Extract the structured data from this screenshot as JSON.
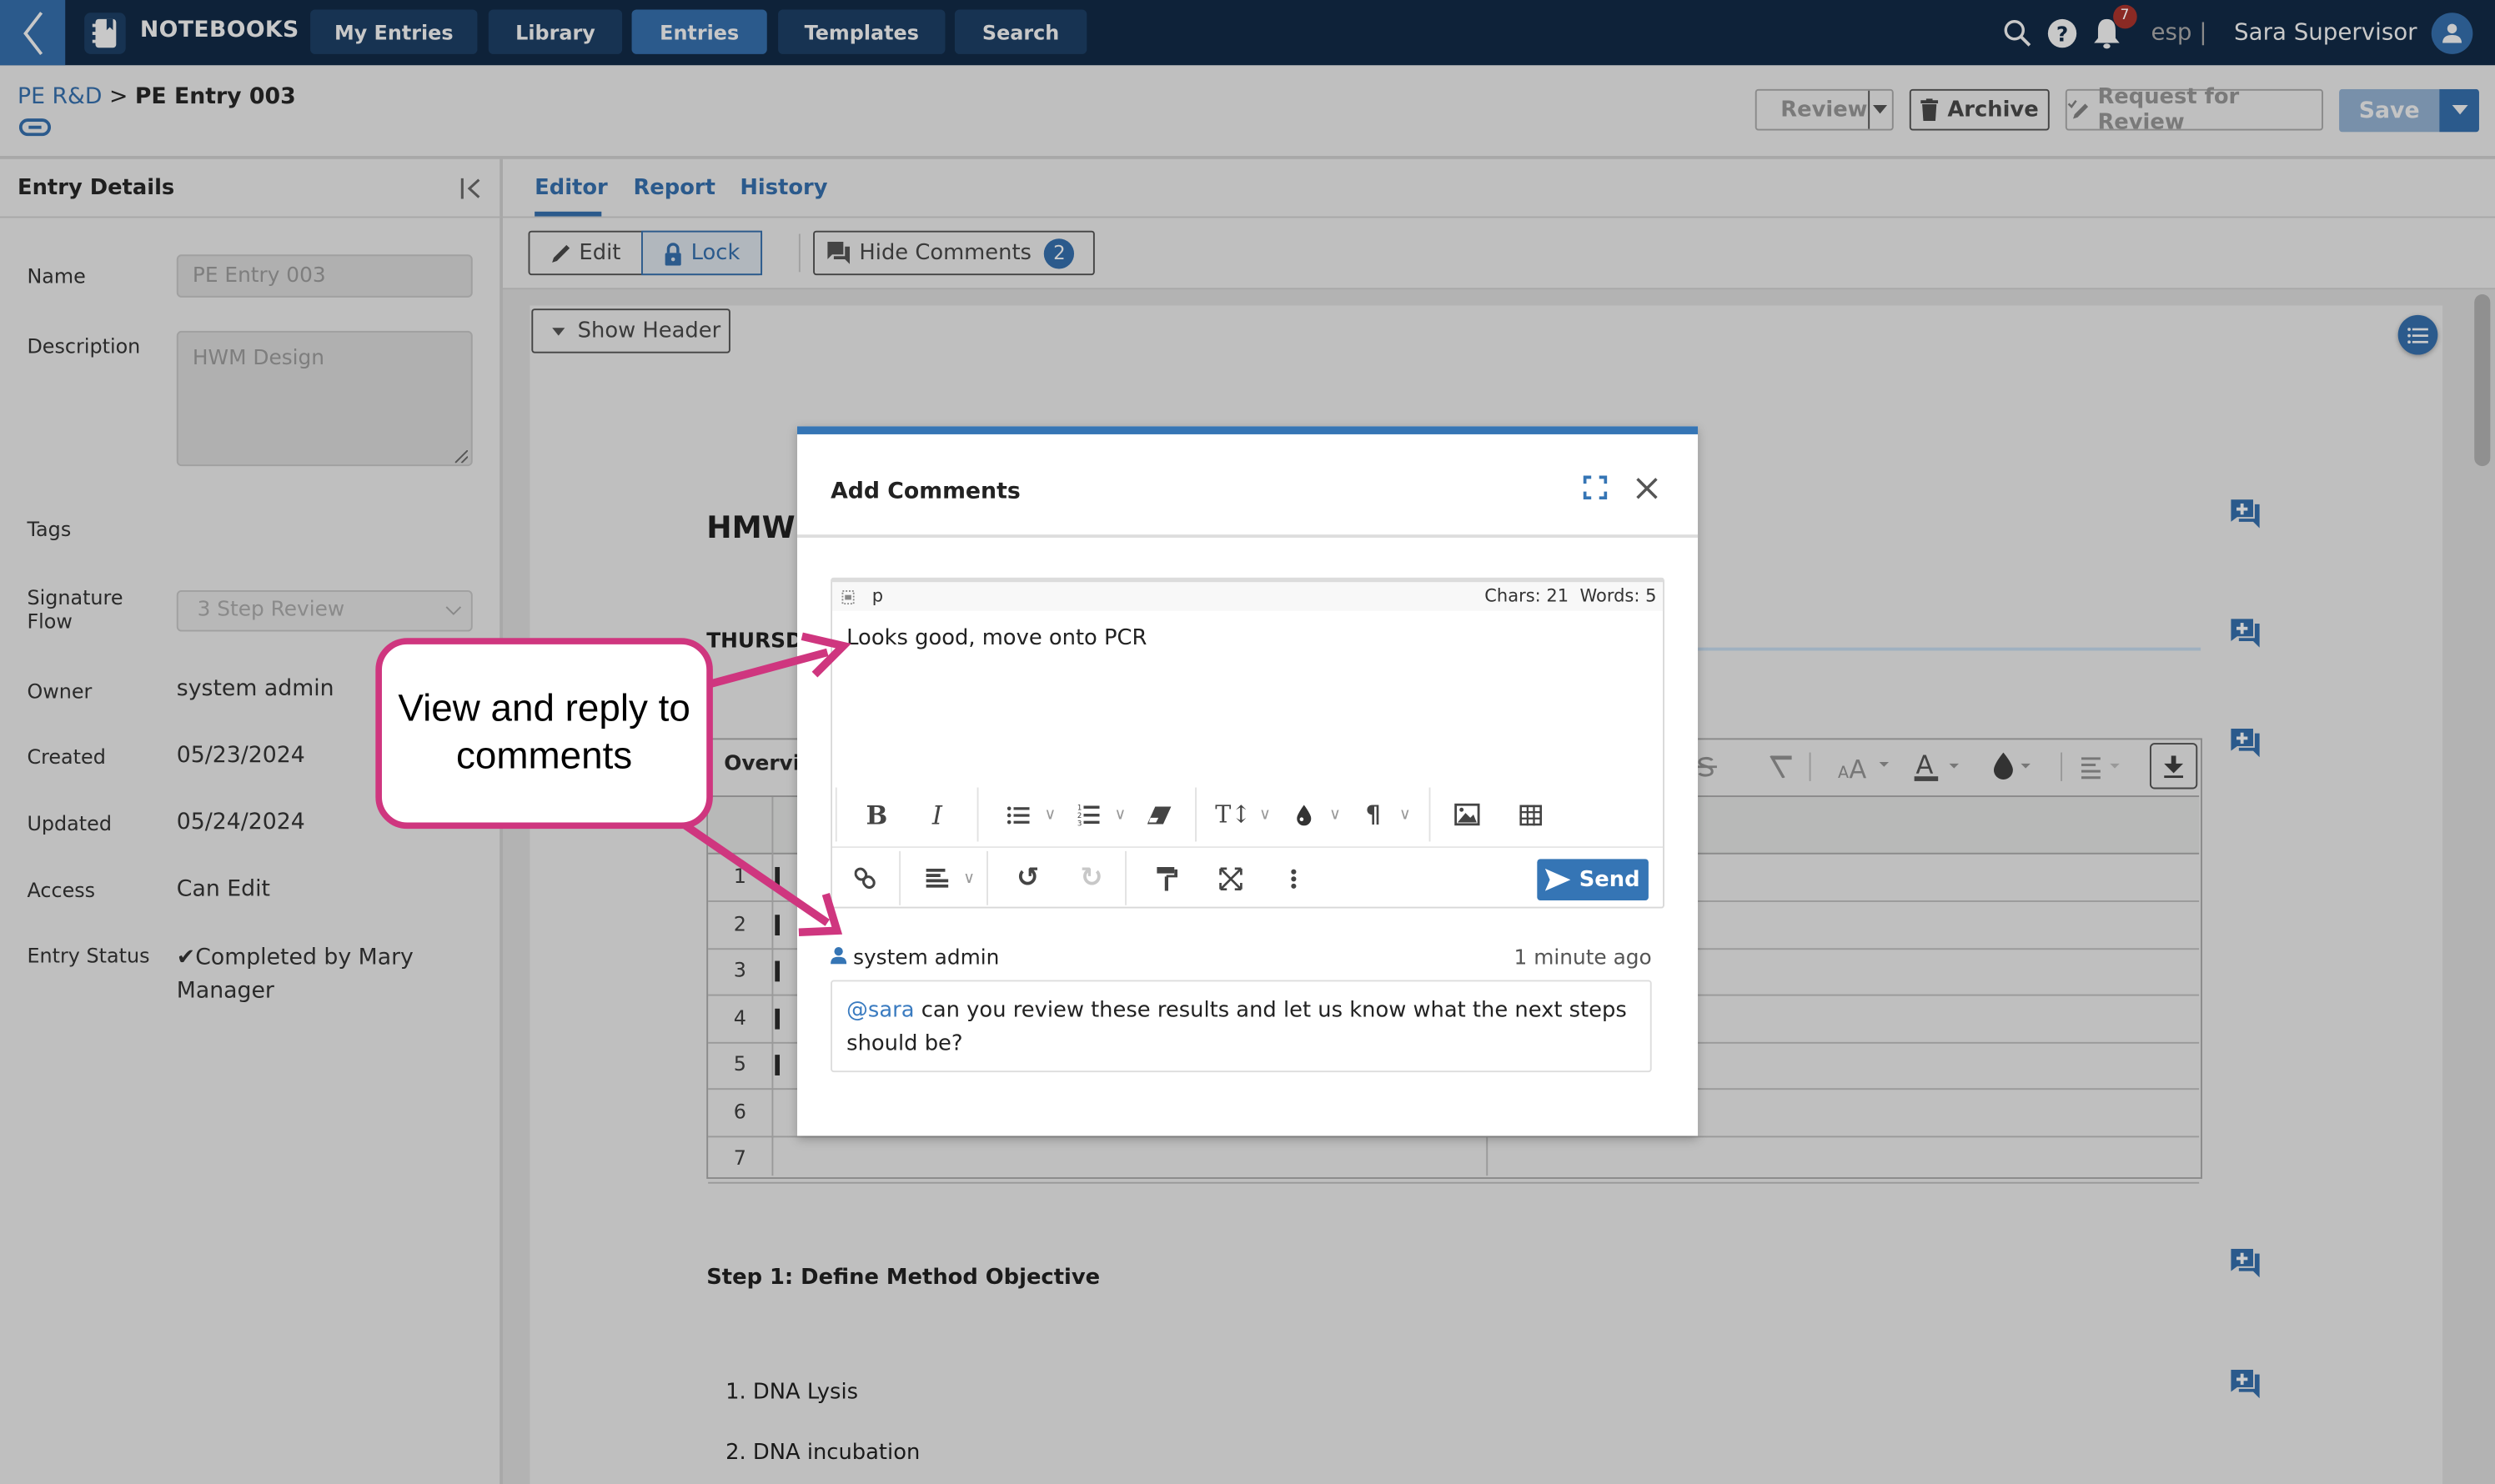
{
  "topnav": {
    "brand": "NOTEBOOKS",
    "items": [
      {
        "label": "My Entries",
        "active": false
      },
      {
        "label": "Library",
        "active": false
      },
      {
        "label": "Entries",
        "active": true
      },
      {
        "label": "Templates",
        "active": false
      },
      {
        "label": "Search",
        "active": false
      }
    ],
    "notification_count": "7",
    "org": "esp |",
    "user": "Sara Supervisor"
  },
  "breadcrumb": {
    "parent": "PE R&D",
    "separator": ">",
    "current": "PE Entry 003"
  },
  "actions": {
    "review": "Review",
    "archive": "Archive",
    "request_review": "Request for Review",
    "save": "Save"
  },
  "entry_details": {
    "title": "Entry Details",
    "name_label": "Name",
    "name_value": "PE Entry 003",
    "description_label": "Description",
    "description_value": "HWM Design",
    "tags_label": "Tags",
    "signature_label_1": "Signature",
    "signature_label_2": "Flow",
    "signature_value": "3 Step Review",
    "owner_label": "Owner",
    "owner_value": "system admin",
    "created_label": "Created",
    "created_value": "05/23/2024",
    "updated_label": "Updated",
    "updated_value": "05/24/2024",
    "access_label": "Access",
    "access_value": "Can Edit",
    "status_label": "Entry Status",
    "status_value": "✔Completed by Mary Manager"
  },
  "tabs": [
    {
      "label": "Editor",
      "active": true
    },
    {
      "label": "Report"
    },
    {
      "label": "History"
    }
  ],
  "toolbar": {
    "edit": "Edit",
    "lock": "Lock",
    "hide_comments": "Hide Comments",
    "comment_count": "2"
  },
  "document": {
    "show_header": "Show Header",
    "title": "HMW",
    "date_heading": "THURSD",
    "table_label": "Overvie",
    "row_numbers": [
      "1",
      "2",
      "3",
      "4",
      "5",
      "6",
      "7"
    ],
    "step1": "Step 1: Define Method Objective",
    "list": [
      "1.  DNA Lysis",
      "2.  DNA incubation"
    ]
  },
  "modal": {
    "title": "Add Comments",
    "status_tag": "p",
    "counts": "Chars: 21  Words: 5",
    "draft": "Looks good, move onto PCR",
    "send": "Send",
    "comment": {
      "author": "system admin",
      "time": "1 minute ago",
      "mention": "@sara",
      "text": " can you review these results and let us know what the next steps should be?"
    }
  },
  "callout": {
    "text": "View and reply to comments"
  },
  "colors": {
    "nav_bg": "#0e2239",
    "accent": "#2b5a8c",
    "modal_accent": "#3575b5",
    "callout": "#cf367f",
    "badge": "#8a2a24"
  }
}
